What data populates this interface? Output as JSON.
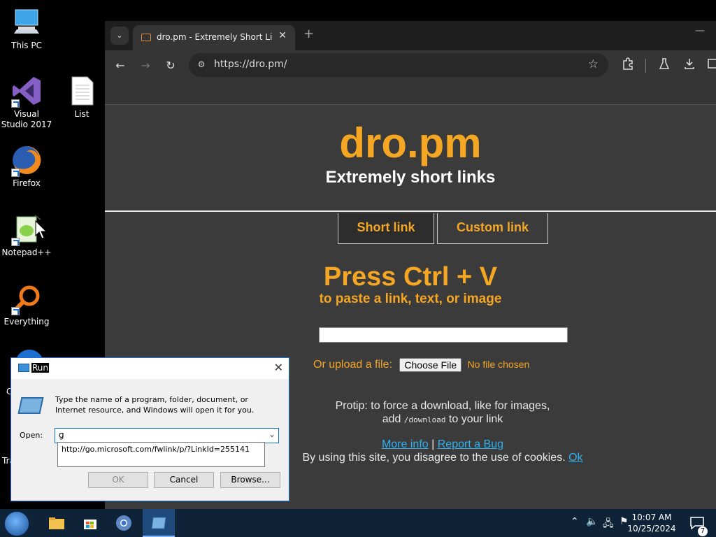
{
  "desktop": {
    "icons": [
      {
        "label": "This PC"
      },
      {
        "label": "Visual Studio 2017"
      },
      {
        "label": "List"
      },
      {
        "label": "Firefox"
      },
      {
        "label": "Notepad++"
      },
      {
        "label": "Everything"
      }
    ],
    "partial_labels": [
      "C",
      "Tra"
    ]
  },
  "browser": {
    "tab": {
      "title": "dro.pm - Extremely Short Links",
      "close": "✕"
    },
    "new_tab": "+",
    "tab_dropdown": "⌄",
    "minimize": "—",
    "address": "https://dro.pm/",
    "nav": {
      "back": "←",
      "forward": "→",
      "reload": "↻"
    }
  },
  "page": {
    "logo": "dro.pm",
    "tagline": "Extremely short links",
    "modes": {
      "short": "Short link",
      "custom": "Custom link"
    },
    "press": "Press Ctrl + V",
    "press_sub": "to paste a link, text, or image",
    "upload_label": "Or upload a file:",
    "choose_file": "Choose File",
    "no_file": "No file chosen",
    "protip_line1": "Protip: to force a download, like for images,",
    "protip_add": "add",
    "protip_code": "/download",
    "protip_end": "to your link",
    "more_info": "More info",
    "separator": "|",
    "report_bug": "Report a Bug",
    "cookies": "By using this site, you disagree to the use of cookies.",
    "ok": "Ok"
  },
  "run_dialog": {
    "title": "Run",
    "description": "Type the name of a program, folder, document, or Internet resource, and Windows will open it for you.",
    "open_label": "Open:",
    "input_value": "g",
    "suggestion": "http://go.microsoft.com/fwlink/p/?LinkId=255141",
    "ok": "OK",
    "cancel": "Cancel",
    "browse": "Browse..."
  },
  "taskbar": {
    "time": "10:07 AM",
    "date": "10/25/2024",
    "notification_count": "7"
  },
  "colors": {
    "accent": "#f5a623",
    "link": "#2fb0f0",
    "page_bg": "#3b3b3b"
  }
}
